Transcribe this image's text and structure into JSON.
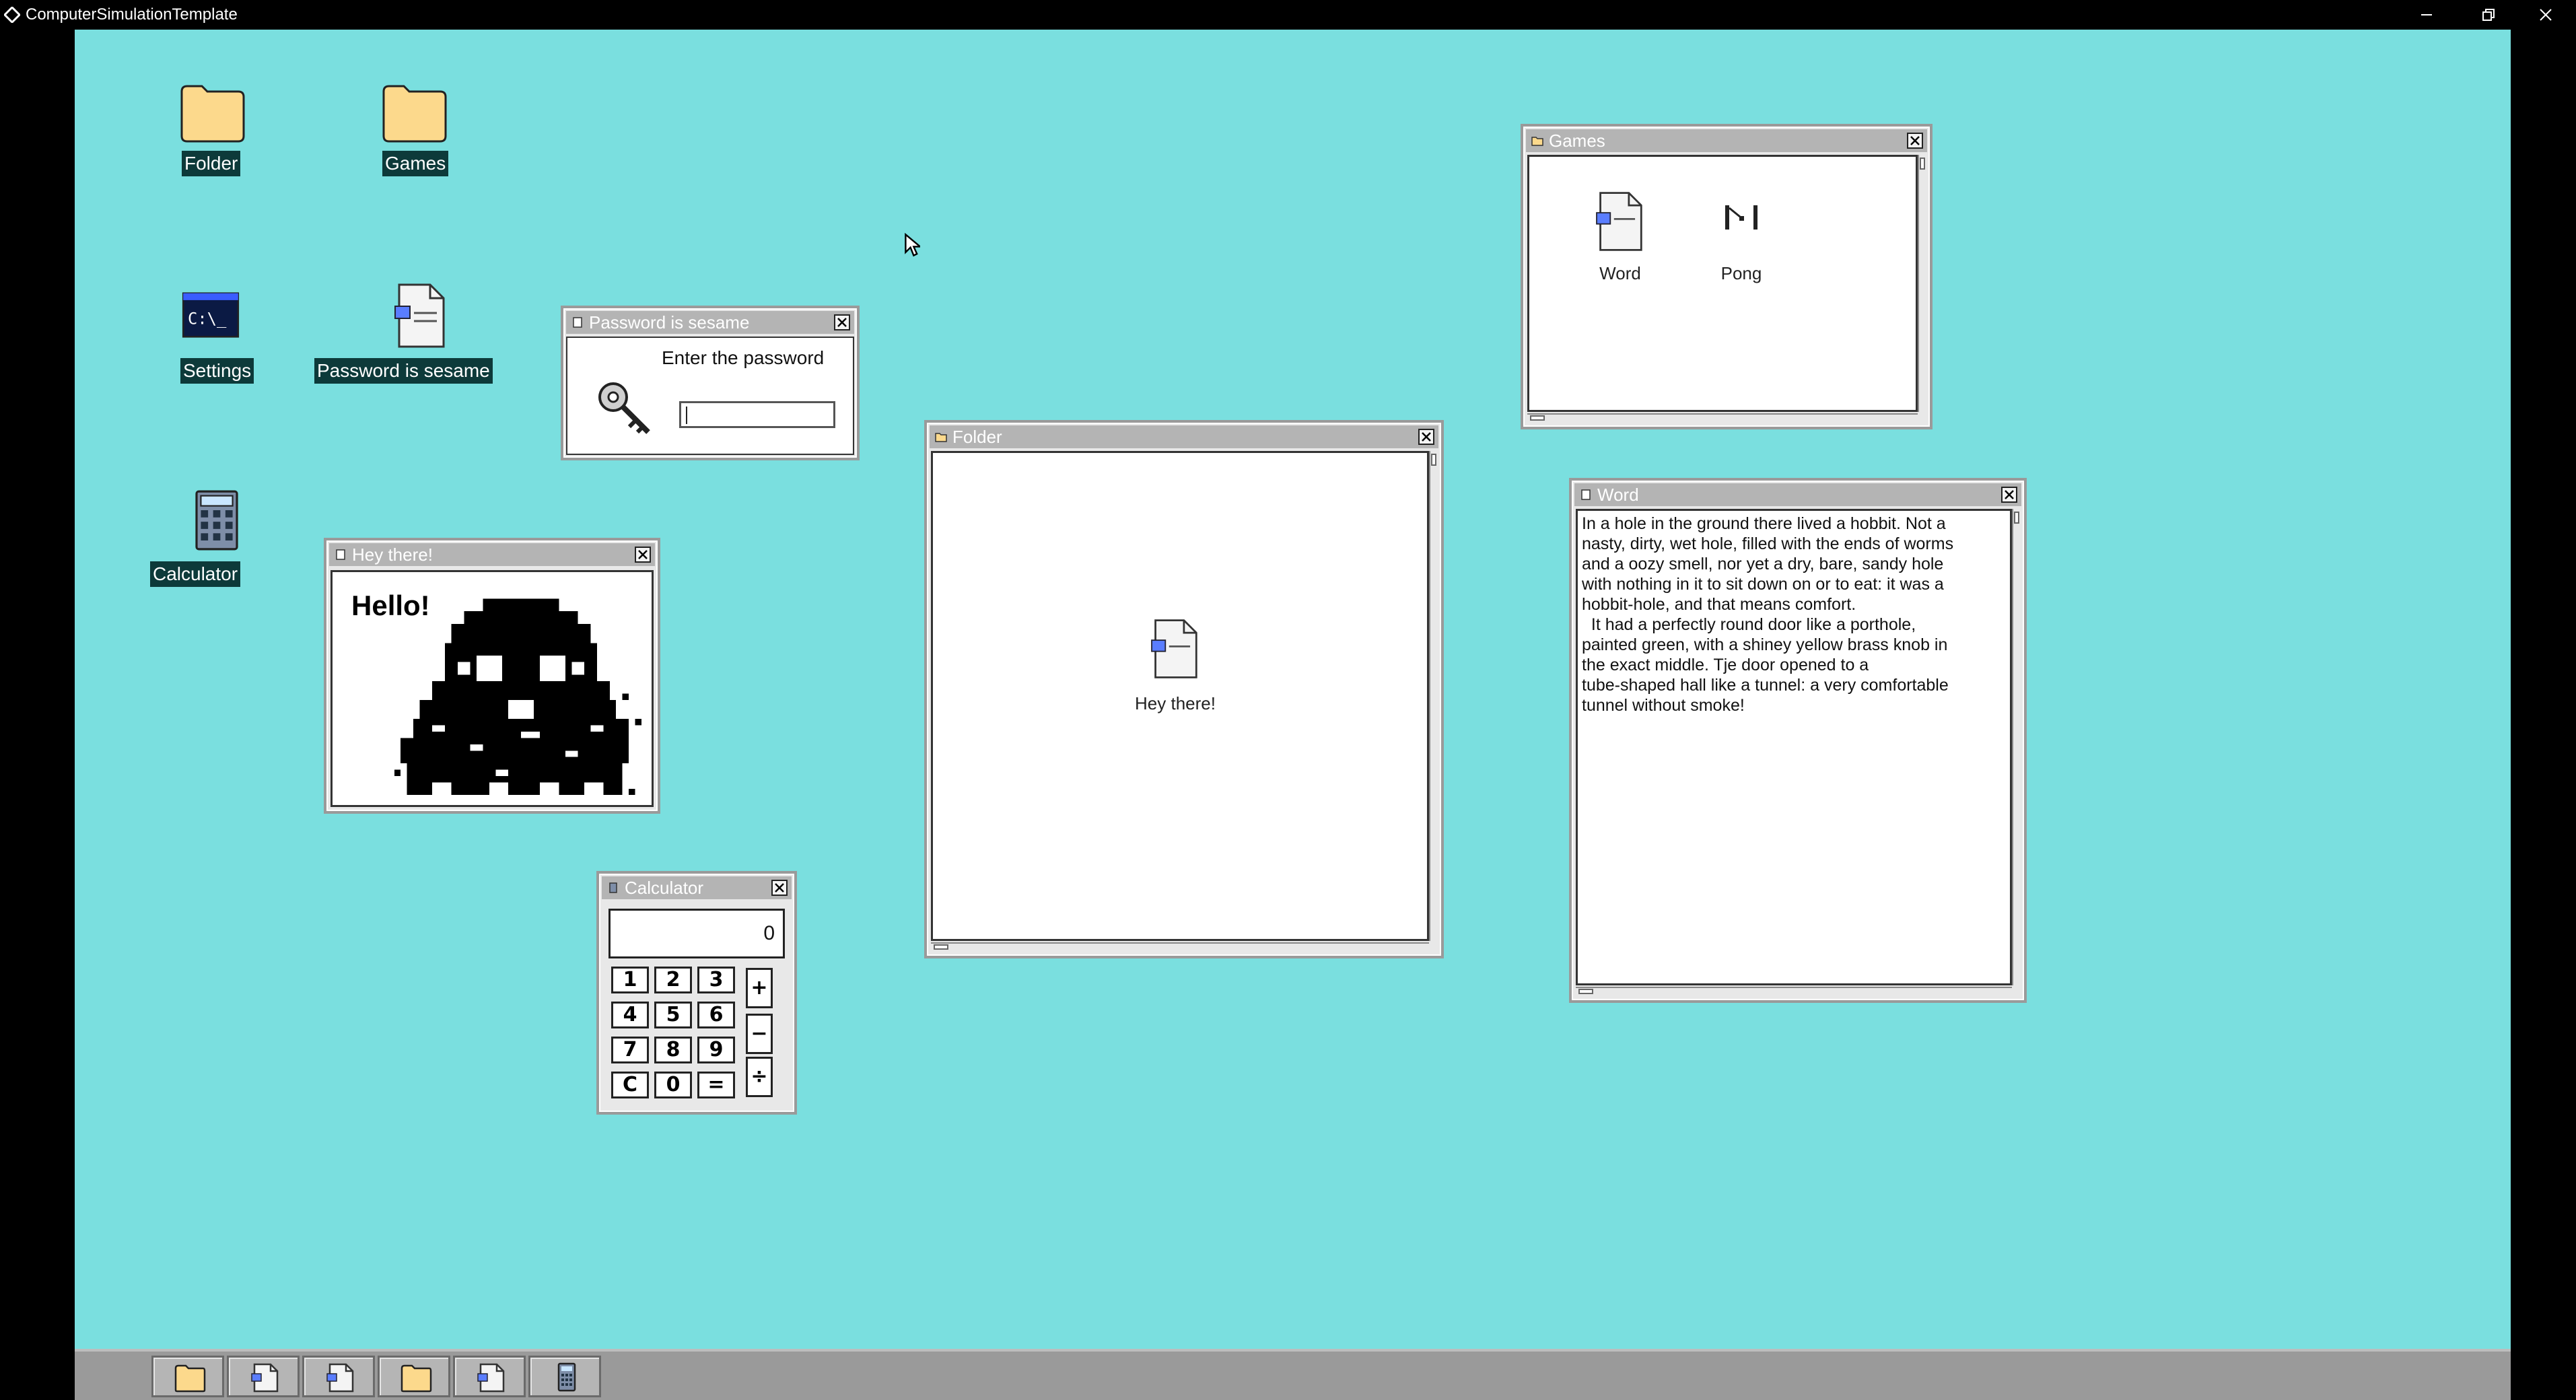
{
  "host_window": {
    "title": "ComputerSimulationTemplate"
  },
  "desktop_icons": {
    "folder": "Folder",
    "games": "Games",
    "settings": "Settings",
    "password_doc": "Password is sesame",
    "calculator": "Calculator"
  },
  "windows": {
    "password": {
      "title": "Password is sesame",
      "prompt": "Enter the password",
      "input_value": ""
    },
    "hey": {
      "title": "Hey there!",
      "greeting": "Hello!"
    },
    "calculator": {
      "title": "Calculator",
      "display": "0",
      "keys": [
        "1",
        "2",
        "3",
        "4",
        "5",
        "6",
        "7",
        "8",
        "9",
        "C",
        "0",
        "="
      ],
      "ops": [
        "+",
        "−",
        "÷"
      ]
    },
    "folder": {
      "title": "Folder",
      "items": [
        {
          "label": "Hey there!",
          "icon": "document-icon"
        }
      ]
    },
    "games": {
      "title": "Games",
      "items": [
        {
          "label": "Word",
          "icon": "document-icon"
        },
        {
          "label": "Pong",
          "icon": "pong-icon"
        }
      ]
    },
    "word": {
      "title": "Word",
      "text": "In a hole in the ground there lived a hobbit. Not a\nnasty, dirty, wet hole, filled with the ends of worms\nand a oozy smell, nor yet a dry, bare, sandy hole\nwith nothing in it to sit down on or to eat: it was a\nhobbit-hole, and that means comfort.\n  It had a perfectly round door like a porthole,\npainted green, with a shiney yellow brass knob in\nthe exact middle. Tje door opened to a\ntube-shaped hall like a tunnel: a very comfortable\ntunnel without smoke!"
    }
  },
  "taskbar": {
    "buttons": [
      "folder-icon",
      "document-icon",
      "document-icon",
      "folder-icon",
      "document-icon",
      "calculator-icon"
    ]
  },
  "colors": {
    "desktop": "#7adfdf",
    "titlebar": "#b4b4b4",
    "label_bg": "#0d3a3a",
    "folder": "#fcd98c"
  }
}
